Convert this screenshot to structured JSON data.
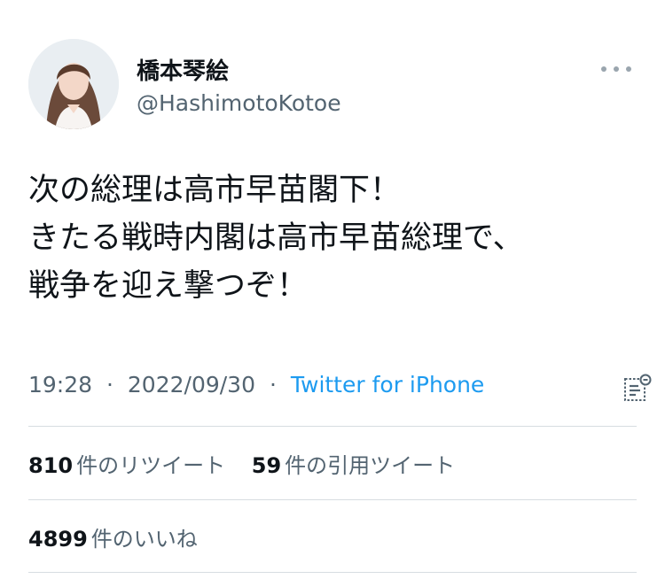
{
  "author": {
    "display_name": "橋本琴絵",
    "handle": "@HashimotoKotoe"
  },
  "tweet": {
    "lines": [
      "次の総理は高市早苗閣下！",
      "きたる戦時内閣は高市早苗総理で、",
      "戦争を迎え撃つぞ！"
    ],
    "time": "19:28",
    "date": "2022/09/30",
    "separator": "·",
    "source": "Twitter for iPhone"
  },
  "stats": {
    "retweets_count": "810",
    "retweets_label": "件のリツイート",
    "quotes_count": "59",
    "quotes_label": "件の引用ツイート",
    "likes_count": "4899",
    "likes_label": "件のいいね"
  },
  "icons": {
    "more": "more-dots-icon",
    "analytics": "analytics-icon"
  },
  "colors": {
    "link": "#1d9bf0",
    "secondary_text": "#536471",
    "divider": "#d7dde1"
  }
}
